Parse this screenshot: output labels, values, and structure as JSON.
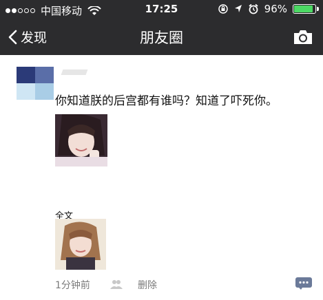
{
  "status_bar": {
    "carrier": "中国移动",
    "time": "17:25",
    "battery": "96%",
    "battery_level": 0.96,
    "signal_bars_filled": 2,
    "signal_bars_total": 5
  },
  "nav": {
    "back_label": "发现",
    "title": "朋友圈"
  },
  "post": {
    "text": "你知道朕的后宫都有谁吗？知道了吓死你。",
    "full_text_label": "全文",
    "time": "1分钟前",
    "delete_label": "删除"
  },
  "colors": {
    "topbar": "#2c2c2e",
    "battery_fill": "#4cd964",
    "meta_text": "#7a7a7a",
    "comment_icon": "#6b7a99"
  },
  "icons": [
    "wifi-icon",
    "lock-rotation-icon",
    "location-icon",
    "alarm-icon",
    "battery-icon",
    "chevron-left-icon",
    "camera-icon",
    "group-icon",
    "comment-icon"
  ]
}
